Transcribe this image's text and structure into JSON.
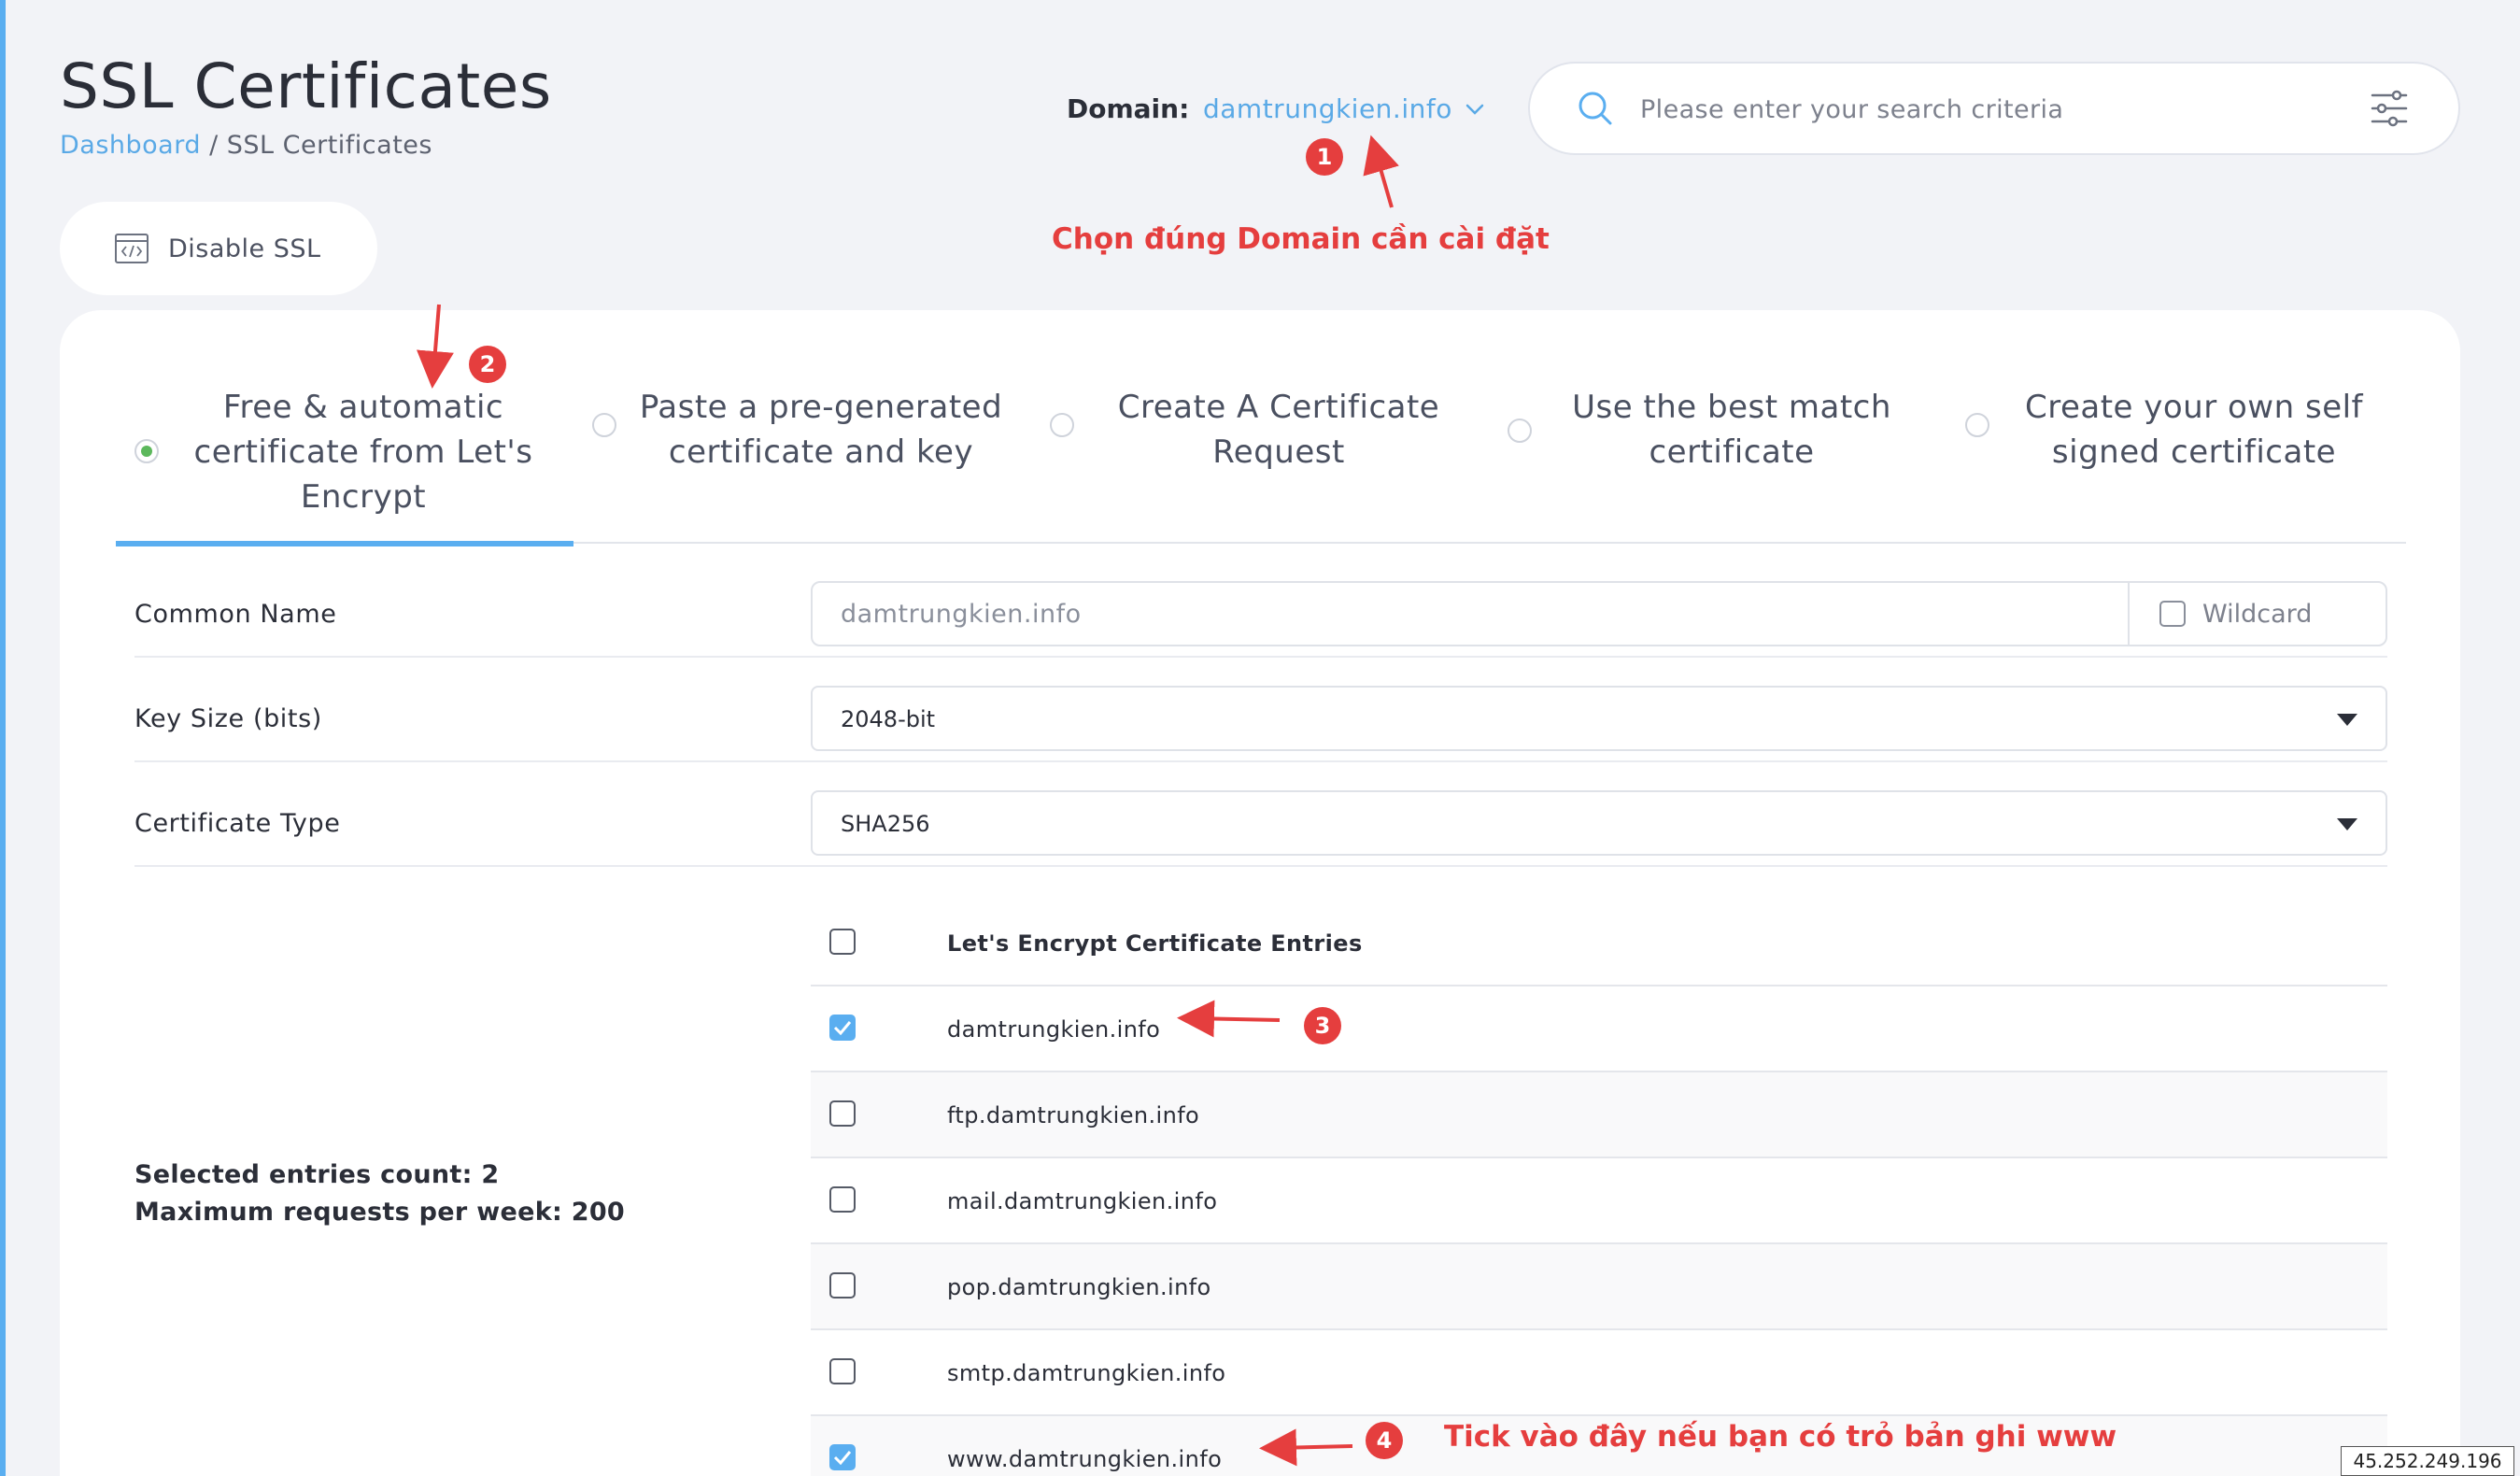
{
  "header": {
    "title": "SSL Certificates",
    "breadcrumb": {
      "home": "Dashboard",
      "separator": " / ",
      "current": "SSL Certificates"
    },
    "domain_label": "Domain:",
    "domain_value": "damtrungkien.info",
    "search_placeholder": "Please enter your search criteria"
  },
  "toolbar": {
    "disable_ssl_label": "Disable SSL"
  },
  "tabs": [
    {
      "label": "Free & automatic certificate from Let's Encrypt",
      "active": true
    },
    {
      "label": "Paste a pre-generated certificate and key",
      "active": false
    },
    {
      "label": "Create A Certificate Request",
      "active": false
    },
    {
      "label": "Use the best match certificate",
      "active": false
    },
    {
      "label": "Create your own self signed certificate",
      "active": false
    }
  ],
  "form": {
    "common_name": {
      "label": "Common Name",
      "value": "damtrungkien.info",
      "wildcard_label": "Wildcard",
      "wildcard_checked": false
    },
    "key_size": {
      "label": "Key Size (bits)",
      "value": "2048-bit"
    },
    "certificate_type": {
      "label": "Certificate Type",
      "value": "SHA256"
    }
  },
  "entries": {
    "header": "Let's Encrypt Certificate Entries",
    "items": [
      {
        "name": "damtrungkien.info",
        "checked": true
      },
      {
        "name": "ftp.damtrungkien.info",
        "checked": false
      },
      {
        "name": "mail.damtrungkien.info",
        "checked": false
      },
      {
        "name": "pop.damtrungkien.info",
        "checked": false
      },
      {
        "name": "smtp.damtrungkien.info",
        "checked": false
      },
      {
        "name": "www.damtrungkien.info",
        "checked": true
      }
    ]
  },
  "stats": {
    "selected_count": "Selected entries count: 2",
    "max_requests": "Maximum requests per week: 200"
  },
  "annotations": {
    "badge_1": "1",
    "badge_2": "2",
    "badge_3": "3",
    "badge_4": "4",
    "note_domain": "Chọn đúng Domain cần cài đặt",
    "note_www": "Tick vào đây nếu bạn có trỏ bản ghi www"
  },
  "ip_address": "45.252.249.196",
  "colors": {
    "accent": "#5aaef0",
    "annotation": "#e53e3e",
    "active_radio": "#5cb85c"
  },
  "icons": {
    "search": "search-icon",
    "filter": "sliders-icon",
    "code": "code-window-icon",
    "chevron": "chevron-down-icon"
  }
}
